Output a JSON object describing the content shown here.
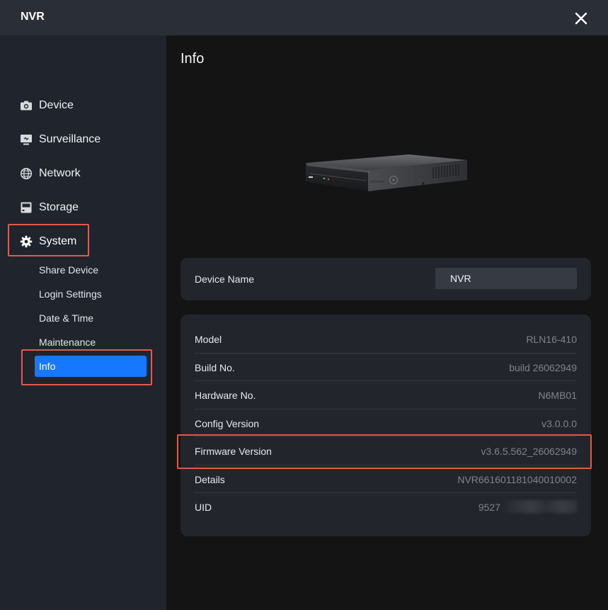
{
  "window": {
    "title": "NVR"
  },
  "sidebar": {
    "items": [
      {
        "id": "device",
        "label": "Device",
        "icon": "camera-icon"
      },
      {
        "id": "surveillance",
        "label": "Surveillance",
        "icon": "monitor-icon"
      },
      {
        "id": "network",
        "label": "Network",
        "icon": "globe-icon"
      },
      {
        "id": "storage",
        "label": "Storage",
        "icon": "storage-icon"
      },
      {
        "id": "system",
        "label": "System",
        "icon": "gear-icon"
      }
    ],
    "system_sub": [
      {
        "label": "Share Device"
      },
      {
        "label": "Login Settings"
      },
      {
        "label": "Date & Time"
      },
      {
        "label": "Maintenance"
      },
      {
        "label": "Info"
      }
    ]
  },
  "main": {
    "title": "Info",
    "device_name": {
      "label": "Device Name",
      "value": "NVR"
    },
    "info": [
      {
        "key": "Model",
        "value": "RLN16-410"
      },
      {
        "key": "Build No.",
        "value": "build 26062949"
      },
      {
        "key": "Hardware No.",
        "value": "N6MB01"
      },
      {
        "key": "Config Version",
        "value": "v3.0.0.0"
      },
      {
        "key": "Firmware Version",
        "value": "v3.6.5.562_26062949"
      },
      {
        "key": "Details",
        "value": "NVR661601181040010002"
      },
      {
        "key": "UID",
        "value": "9527"
      }
    ]
  },
  "colors": {
    "accent": "#1677ff",
    "highlight": "#e8574b",
    "sidebar_bg": "#20242c",
    "card_bg": "#22252b"
  }
}
